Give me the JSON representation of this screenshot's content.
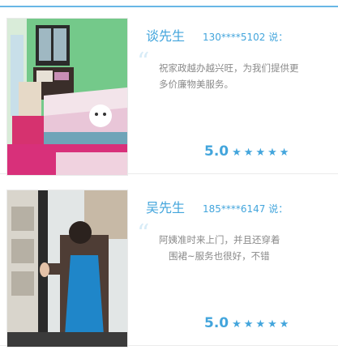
{
  "reviews": [
    {
      "name": "谈先生",
      "phone": "130****5102 说：",
      "comment_lines": [
        "祝家政越办越兴旺，为我们提供更",
        "多价廉物美服务。"
      ],
      "score": "5.0",
      "stars": 5,
      "photo_desc": "bedroom with pink bedding and green walls"
    },
    {
      "name": "吴先生",
      "phone": "185****6147 说：",
      "comment_lines": [
        "阿姨准时来上门，并且还穿着",
        "围裙~服务也很好，不错"
      ],
      "score": "5.0",
      "stars": 5,
      "photo_desc": "housekeeper in blue apron cleaning window"
    }
  ],
  "colors": {
    "accent": "#43a5dc",
    "rule": "#69b7e6",
    "text_muted": "#8a8a8a"
  },
  "icons": {
    "quote": "left-double-quote-icon",
    "star": "star-icon"
  }
}
